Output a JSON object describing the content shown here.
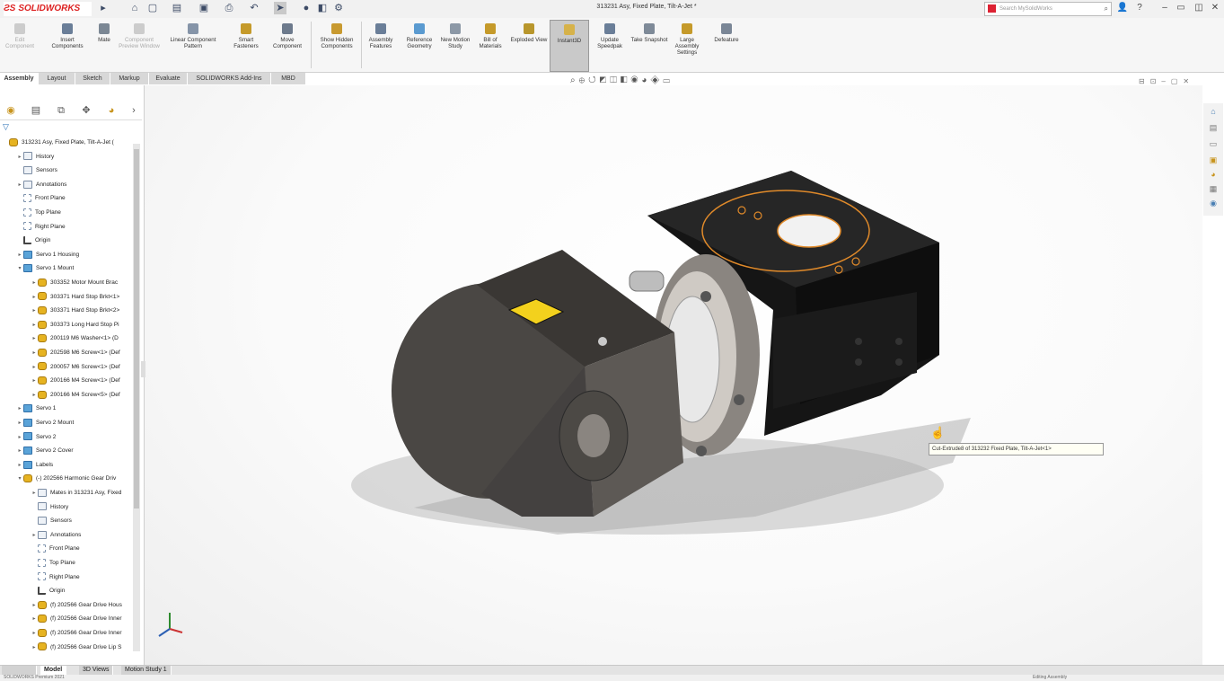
{
  "app": {
    "logo_text": "SOLIDWORKS",
    "document_title": "313231 Asy, Fixed Plate, Tilt-A-Jet *"
  },
  "search": {
    "placeholder": "Search MySolidWorks"
  },
  "commands": [
    {
      "label": "Edit Component",
      "disabled": true
    },
    {
      "label": "Insert Components",
      "disabled": false
    },
    {
      "label": "Mate",
      "disabled": false
    },
    {
      "label": "Component Preview Window",
      "disabled": true
    },
    {
      "label": "Linear Component Pattern",
      "disabled": false
    },
    {
      "label": "Smart Fasteners",
      "disabled": false
    },
    {
      "label": "Move Component",
      "disabled": false
    },
    {
      "label": "Show Hidden Components",
      "disabled": false
    },
    {
      "label": "Assembly Features",
      "disabled": false
    },
    {
      "label": "Reference Geometry",
      "disabled": false
    },
    {
      "label": "New Motion Study",
      "disabled": false
    },
    {
      "label": "Bill of Materials",
      "disabled": false
    },
    {
      "label": "Exploded View",
      "disabled": false
    },
    {
      "label": "Instant3D",
      "disabled": false,
      "active": true
    },
    {
      "label": "Update Speedpak",
      "disabled": false
    },
    {
      "label": "Take Snapshot",
      "disabled": false
    },
    {
      "label": "Large Assembly Settings",
      "disabled": false
    },
    {
      "label": "Defeature",
      "disabled": false
    }
  ],
  "tabs": [
    "Assembly",
    "Layout",
    "Sketch",
    "Markup",
    "Evaluate",
    "SOLIDWORKS Add-Ins",
    "MBD"
  ],
  "tree": [
    {
      "label": "313231 Asy, Fixed Plate, Tilt-A-Jet (",
      "icon": "yellow",
      "indent": 0,
      "expander": ""
    },
    {
      "label": "History",
      "icon": "folder",
      "indent": 1,
      "expander": "▸"
    },
    {
      "label": "Sensors",
      "icon": "folder",
      "indent": 1,
      "expander": ""
    },
    {
      "label": "Annotations",
      "icon": "folder",
      "indent": 1,
      "expander": "▸"
    },
    {
      "label": "Front Plane",
      "icon": "plane",
      "indent": 1,
      "expander": ""
    },
    {
      "label": "Top Plane",
      "icon": "plane",
      "indent": 1,
      "expander": ""
    },
    {
      "label": "Right Plane",
      "icon": "plane",
      "indent": 1,
      "expander": ""
    },
    {
      "label": "Origin",
      "icon": "origin",
      "indent": 1,
      "expander": ""
    },
    {
      "label": "Servo 1 Housing",
      "icon": "blue",
      "indent": 1,
      "expander": "▸"
    },
    {
      "label": "Servo 1 Mount",
      "icon": "blue",
      "indent": 1,
      "expander": "▾"
    },
    {
      "label": "303352 Motor Mount Brac",
      "icon": "yellow",
      "indent": 2,
      "expander": "▸"
    },
    {
      "label": "303371 Hard Stop Brkt<1>",
      "icon": "yellow",
      "indent": 2,
      "expander": "▸"
    },
    {
      "label": "303371 Hard Stop Brkt<2>",
      "icon": "yellow",
      "indent": 2,
      "expander": "▸"
    },
    {
      "label": "303373 Long Hard Stop Pi",
      "icon": "yellow",
      "indent": 2,
      "expander": "▸"
    },
    {
      "label": "200119 M6 Washer<1> (D",
      "icon": "yellow",
      "indent": 2,
      "expander": "▸"
    },
    {
      "label": "202598 M6 Screw<1> (Def",
      "icon": "yellow",
      "indent": 2,
      "expander": "▸"
    },
    {
      "label": "200057 M6 Screw<1> (Def",
      "icon": "yellow",
      "indent": 2,
      "expander": "▸"
    },
    {
      "label": "200166 M4 Screw<1> (Def",
      "icon": "yellow",
      "indent": 2,
      "expander": "▸"
    },
    {
      "label": "200166 M4 Screw<5> (Def",
      "icon": "yellow",
      "indent": 2,
      "expander": "▸"
    },
    {
      "label": "Servo 1",
      "icon": "blue",
      "indent": 1,
      "expander": "▸"
    },
    {
      "label": "Servo 2 Mount",
      "icon": "blue",
      "indent": 1,
      "expander": "▸"
    },
    {
      "label": "Servo 2",
      "icon": "blue",
      "indent": 1,
      "expander": "▸"
    },
    {
      "label": "Servo 2 Cover",
      "icon": "blue",
      "indent": 1,
      "expander": "▸"
    },
    {
      "label": "Labels",
      "icon": "blue",
      "indent": 1,
      "expander": "▸"
    },
    {
      "label": "(-) 202566 Harmonic Gear Driv",
      "icon": "yellow",
      "indent": 1,
      "expander": "▾"
    },
    {
      "label": "Mates in 313231 Asy, Fixed",
      "icon": "folder",
      "indent": 2,
      "expander": "▸"
    },
    {
      "label": "History",
      "icon": "folder",
      "indent": 2,
      "expander": ""
    },
    {
      "label": "Sensors",
      "icon": "folder",
      "indent": 2,
      "expander": ""
    },
    {
      "label": "Annotations",
      "icon": "folder",
      "indent": 2,
      "expander": "▸"
    },
    {
      "label": "Front Plane",
      "icon": "plane",
      "indent": 2,
      "expander": ""
    },
    {
      "label": "Top Plane",
      "icon": "plane",
      "indent": 2,
      "expander": ""
    },
    {
      "label": "Right Plane",
      "icon": "plane",
      "indent": 2,
      "expander": ""
    },
    {
      "label": "Origin",
      "icon": "origin",
      "indent": 2,
      "expander": ""
    },
    {
      "label": "(f) 202566 Gear Drive Hous",
      "icon": "yellow",
      "indent": 2,
      "expander": "▸"
    },
    {
      "label": "(f) 202566 Gear Drive Inner",
      "icon": "yellow",
      "indent": 2,
      "expander": "▸"
    },
    {
      "label": "(f) 202566 Gear Drive Inner",
      "icon": "yellow",
      "indent": 2,
      "expander": "▸"
    },
    {
      "label": "(f) 202566 Gear Drive Lip S",
      "icon": "yellow",
      "indent": 2,
      "expander": "▸"
    }
  ],
  "tooltip": {
    "text": "Cut-Extrude8 of 313232 Fixed Plate, Tilt-A-Jet<1>"
  },
  "bottom_tabs": [
    "Model",
    "3D Views",
    "Motion Study 1"
  ],
  "status": {
    "left": "SOLIDWORKS Premium 2021",
    "right": "Editing Assembly"
  },
  "colors": {
    "accent": "#d22b2b",
    "selection": "#e08a2a",
    "instant3d_active": "#c9c9c9"
  }
}
